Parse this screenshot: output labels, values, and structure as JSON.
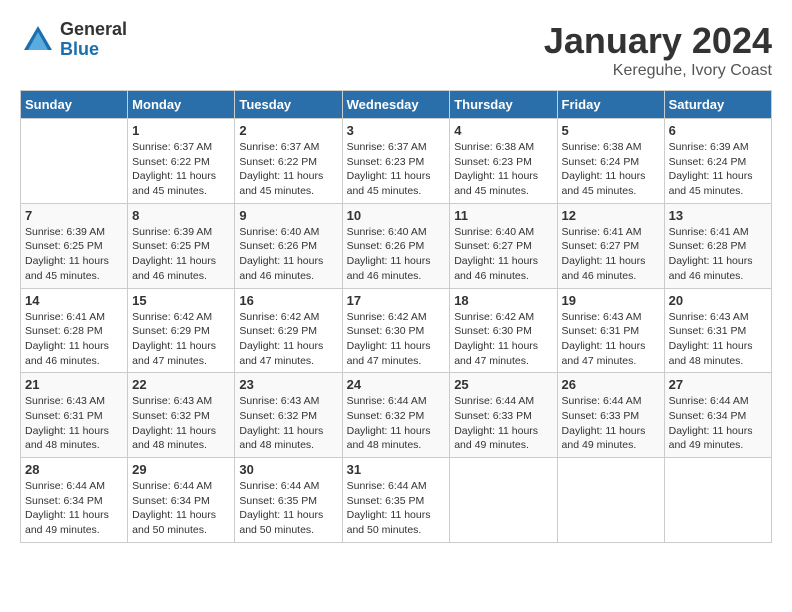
{
  "logo": {
    "general": "General",
    "blue": "Blue"
  },
  "title": "January 2024",
  "location": "Kereguhe, Ivory Coast",
  "days_of_week": [
    "Sunday",
    "Monday",
    "Tuesday",
    "Wednesday",
    "Thursday",
    "Friday",
    "Saturday"
  ],
  "weeks": [
    [
      {
        "day": "",
        "sunrise": "",
        "sunset": "",
        "daylight": ""
      },
      {
        "day": "1",
        "sunrise": "Sunrise: 6:37 AM",
        "sunset": "Sunset: 6:22 PM",
        "daylight": "Daylight: 11 hours and 45 minutes."
      },
      {
        "day": "2",
        "sunrise": "Sunrise: 6:37 AM",
        "sunset": "Sunset: 6:22 PM",
        "daylight": "Daylight: 11 hours and 45 minutes."
      },
      {
        "day": "3",
        "sunrise": "Sunrise: 6:37 AM",
        "sunset": "Sunset: 6:23 PM",
        "daylight": "Daylight: 11 hours and 45 minutes."
      },
      {
        "day": "4",
        "sunrise": "Sunrise: 6:38 AM",
        "sunset": "Sunset: 6:23 PM",
        "daylight": "Daylight: 11 hours and 45 minutes."
      },
      {
        "day": "5",
        "sunrise": "Sunrise: 6:38 AM",
        "sunset": "Sunset: 6:24 PM",
        "daylight": "Daylight: 11 hours and 45 minutes."
      },
      {
        "day": "6",
        "sunrise": "Sunrise: 6:39 AM",
        "sunset": "Sunset: 6:24 PM",
        "daylight": "Daylight: 11 hours and 45 minutes."
      }
    ],
    [
      {
        "day": "7",
        "sunrise": "Sunrise: 6:39 AM",
        "sunset": "Sunset: 6:25 PM",
        "daylight": "Daylight: 11 hours and 45 minutes."
      },
      {
        "day": "8",
        "sunrise": "Sunrise: 6:39 AM",
        "sunset": "Sunset: 6:25 PM",
        "daylight": "Daylight: 11 hours and 46 minutes."
      },
      {
        "day": "9",
        "sunrise": "Sunrise: 6:40 AM",
        "sunset": "Sunset: 6:26 PM",
        "daylight": "Daylight: 11 hours and 46 minutes."
      },
      {
        "day": "10",
        "sunrise": "Sunrise: 6:40 AM",
        "sunset": "Sunset: 6:26 PM",
        "daylight": "Daylight: 11 hours and 46 minutes."
      },
      {
        "day": "11",
        "sunrise": "Sunrise: 6:40 AM",
        "sunset": "Sunset: 6:27 PM",
        "daylight": "Daylight: 11 hours and 46 minutes."
      },
      {
        "day": "12",
        "sunrise": "Sunrise: 6:41 AM",
        "sunset": "Sunset: 6:27 PM",
        "daylight": "Daylight: 11 hours and 46 minutes."
      },
      {
        "day": "13",
        "sunrise": "Sunrise: 6:41 AM",
        "sunset": "Sunset: 6:28 PM",
        "daylight": "Daylight: 11 hours and 46 minutes."
      }
    ],
    [
      {
        "day": "14",
        "sunrise": "Sunrise: 6:41 AM",
        "sunset": "Sunset: 6:28 PM",
        "daylight": "Daylight: 11 hours and 46 minutes."
      },
      {
        "day": "15",
        "sunrise": "Sunrise: 6:42 AM",
        "sunset": "Sunset: 6:29 PM",
        "daylight": "Daylight: 11 hours and 47 minutes."
      },
      {
        "day": "16",
        "sunrise": "Sunrise: 6:42 AM",
        "sunset": "Sunset: 6:29 PM",
        "daylight": "Daylight: 11 hours and 47 minutes."
      },
      {
        "day": "17",
        "sunrise": "Sunrise: 6:42 AM",
        "sunset": "Sunset: 6:30 PM",
        "daylight": "Daylight: 11 hours and 47 minutes."
      },
      {
        "day": "18",
        "sunrise": "Sunrise: 6:42 AM",
        "sunset": "Sunset: 6:30 PM",
        "daylight": "Daylight: 11 hours and 47 minutes."
      },
      {
        "day": "19",
        "sunrise": "Sunrise: 6:43 AM",
        "sunset": "Sunset: 6:31 PM",
        "daylight": "Daylight: 11 hours and 47 minutes."
      },
      {
        "day": "20",
        "sunrise": "Sunrise: 6:43 AM",
        "sunset": "Sunset: 6:31 PM",
        "daylight": "Daylight: 11 hours and 48 minutes."
      }
    ],
    [
      {
        "day": "21",
        "sunrise": "Sunrise: 6:43 AM",
        "sunset": "Sunset: 6:31 PM",
        "daylight": "Daylight: 11 hours and 48 minutes."
      },
      {
        "day": "22",
        "sunrise": "Sunrise: 6:43 AM",
        "sunset": "Sunset: 6:32 PM",
        "daylight": "Daylight: 11 hours and 48 minutes."
      },
      {
        "day": "23",
        "sunrise": "Sunrise: 6:43 AM",
        "sunset": "Sunset: 6:32 PM",
        "daylight": "Daylight: 11 hours and 48 minutes."
      },
      {
        "day": "24",
        "sunrise": "Sunrise: 6:44 AM",
        "sunset": "Sunset: 6:32 PM",
        "daylight": "Daylight: 11 hours and 48 minutes."
      },
      {
        "day": "25",
        "sunrise": "Sunrise: 6:44 AM",
        "sunset": "Sunset: 6:33 PM",
        "daylight": "Daylight: 11 hours and 49 minutes."
      },
      {
        "day": "26",
        "sunrise": "Sunrise: 6:44 AM",
        "sunset": "Sunset: 6:33 PM",
        "daylight": "Daylight: 11 hours and 49 minutes."
      },
      {
        "day": "27",
        "sunrise": "Sunrise: 6:44 AM",
        "sunset": "Sunset: 6:34 PM",
        "daylight": "Daylight: 11 hours and 49 minutes."
      }
    ],
    [
      {
        "day": "28",
        "sunrise": "Sunrise: 6:44 AM",
        "sunset": "Sunset: 6:34 PM",
        "daylight": "Daylight: 11 hours and 49 minutes."
      },
      {
        "day": "29",
        "sunrise": "Sunrise: 6:44 AM",
        "sunset": "Sunset: 6:34 PM",
        "daylight": "Daylight: 11 hours and 50 minutes."
      },
      {
        "day": "30",
        "sunrise": "Sunrise: 6:44 AM",
        "sunset": "Sunset: 6:35 PM",
        "daylight": "Daylight: 11 hours and 50 minutes."
      },
      {
        "day": "31",
        "sunrise": "Sunrise: 6:44 AM",
        "sunset": "Sunset: 6:35 PM",
        "daylight": "Daylight: 11 hours and 50 minutes."
      },
      {
        "day": "",
        "sunrise": "",
        "sunset": "",
        "daylight": ""
      },
      {
        "day": "",
        "sunrise": "",
        "sunset": "",
        "daylight": ""
      },
      {
        "day": "",
        "sunrise": "",
        "sunset": "",
        "daylight": ""
      }
    ]
  ]
}
